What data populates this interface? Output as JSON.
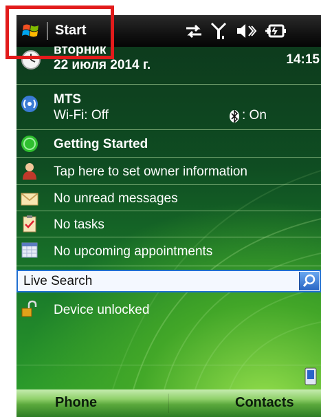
{
  "titlebar": {
    "title": "Start",
    "icons": [
      "windows-logo-icon",
      "connectivity-arrows-icon",
      "signal-strength-icon",
      "speaker-muted-icon",
      "battery-charging-icon"
    ]
  },
  "today": {
    "day": "вторник",
    "date": "22 июля 2014 г.",
    "time": "14:15"
  },
  "network": {
    "operator": "MTS",
    "wifi": "Wi-Fi: Off",
    "bluetooth": ": On"
  },
  "items": {
    "getting_started": "Getting Started",
    "owner": "Tap here to set owner information",
    "messages": "No unread messages",
    "tasks": "No tasks",
    "appointments": "No upcoming appointments"
  },
  "search": {
    "label": "Live Search"
  },
  "lock": {
    "status": "Device unlocked"
  },
  "softkeys": {
    "left": "Phone",
    "right": "Contacts"
  },
  "colors": {
    "highlight": "#e21b1b",
    "search_border": "#1f6fd0"
  }
}
